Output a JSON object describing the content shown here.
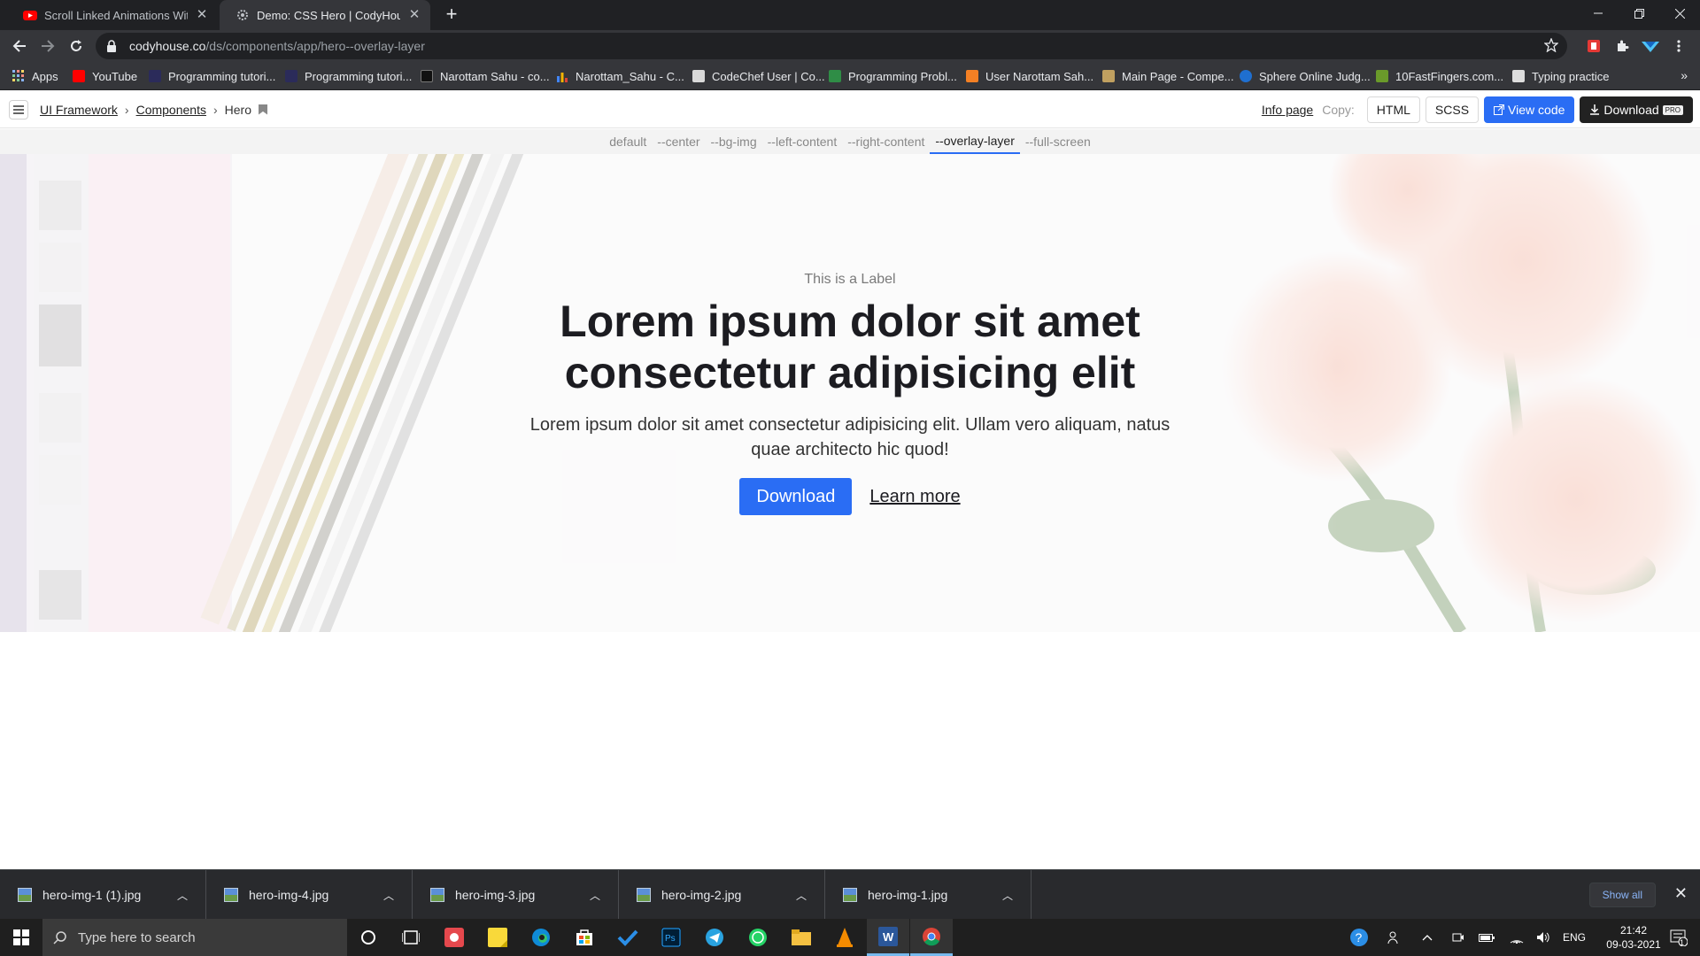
{
  "browser": {
    "tabs": [
      {
        "title": "Scroll Linked Animations With N",
        "active": false
      },
      {
        "title": "Demo: CSS Hero | CodyHouse",
        "active": true
      }
    ],
    "url_host": "codyhouse.co",
    "url_path": "/ds/components/app/hero--overlay-layer"
  },
  "bookmarks": [
    {
      "label": "Apps",
      "color": "#4285f4"
    },
    {
      "label": "YouTube",
      "color": "#ff0000"
    },
    {
      "label": "Programming tutori...",
      "color": "#2b2b5a"
    },
    {
      "label": "Programming tutori...",
      "color": "#2b2b5a"
    },
    {
      "label": "Narottam Sahu - co...",
      "color": "#111111"
    },
    {
      "label": "Narottam_Sahu - C...",
      "color": "#f4b400"
    },
    {
      "label": "CodeChef User | Co...",
      "color": "#d9d9d9"
    },
    {
      "label": "Programming Probl...",
      "color": "#2f8d46"
    },
    {
      "label": "User Narottam Sah...",
      "color": "#f48024"
    },
    {
      "label": "Main Page - Compe...",
      "color": "#c0a060"
    },
    {
      "label": "Sphere Online Judg...",
      "color": "#1f6fd0"
    },
    {
      "label": "10FastFingers.com...",
      "color": "#6a9a2a"
    },
    {
      "label": "Typing practice",
      "color": "#dddddd"
    }
  ],
  "header": {
    "breadcrumbs": [
      "UI Framework",
      "Components",
      "Hero"
    ],
    "info_link": "Info page",
    "copy_label": "Copy:",
    "html_btn": "HTML",
    "scss_btn": "SCSS",
    "view_code_btn": "View code",
    "download_btn": "Download",
    "pro_badge": "PRO"
  },
  "variants": {
    "items": [
      "default",
      "--center",
      "--bg-img",
      "--left-content",
      "--right-content",
      "--overlay-layer",
      "--full-screen"
    ],
    "active": "--overlay-layer"
  },
  "hero": {
    "label": "This is a Label",
    "title": "Lorem ipsum dolor sit amet consectetur adipisicing elit",
    "text": "Lorem ipsum dolor sit amet consectetur adipisicing elit. Ullam vero aliquam, natus quae architecto hic quod!",
    "primary_btn": "Download",
    "link": "Learn more"
  },
  "downloads": {
    "files": [
      "hero-img-1 (1).jpg",
      "hero-img-4.jpg",
      "hero-img-3.jpg",
      "hero-img-2.jpg",
      "hero-img-1.jpg"
    ],
    "show_all": "Show all"
  },
  "taskbar": {
    "search_placeholder": "Type here to search",
    "language": "ENG",
    "time": "21:42",
    "date": "09-03-2021",
    "notification_count": "1"
  },
  "colors": {
    "accent": "#2a6df4",
    "chrome_dark": "#202124",
    "chrome_mid": "#35363a",
    "hero_title": "#1c1c21"
  }
}
